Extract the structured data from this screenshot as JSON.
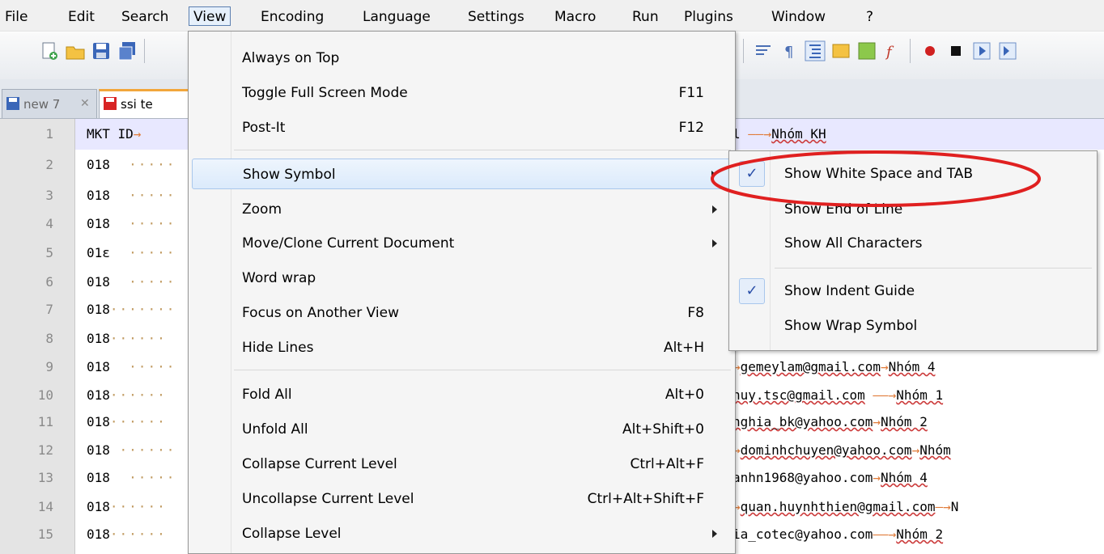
{
  "menubar": [
    {
      "label": "File",
      "open": false
    },
    {
      "label": "Edit",
      "open": false
    },
    {
      "label": "Search",
      "open": false
    },
    {
      "label": "View",
      "open": true
    },
    {
      "label": "Encoding",
      "open": false
    },
    {
      "label": "Language",
      "open": false
    },
    {
      "label": "Settings",
      "open": false
    },
    {
      "label": "Macro",
      "open": false
    },
    {
      "label": "Run",
      "open": false
    },
    {
      "label": "Plugins",
      "open": false
    },
    {
      "label": "Window",
      "open": false
    },
    {
      "label": "?",
      "open": false
    }
  ],
  "tabs": [
    {
      "label": "new  7",
      "active": false
    },
    {
      "label": "ssi te",
      "active": true
    }
  ],
  "editor": {
    "line_numbers": [
      "1",
      "2",
      "3",
      "4",
      "5",
      "6",
      "7",
      "8",
      "9",
      "10",
      "11",
      "12",
      "13",
      "14",
      "15"
    ],
    "header_text": "MKT ID",
    "left_codes": [
      "018",
      "018",
      "018",
      "01ε",
      "018",
      "018",
      "018",
      "018",
      "018",
      "018",
      "018",
      "018",
      "018",
      "018"
    ],
    "right_lines": [
      {
        "pre": "l ",
        "email": "Nhóm KH",
        "suffix": ""
      },
      {
        "pre": "",
        "email": "gemeylam@gmail.com",
        "suffix": "Nhóm 4"
      },
      {
        "pre": "",
        "email": "huy.tsc@gmail.com",
        "suffix": "Nhóm 1"
      },
      {
        "pre": "",
        "email": "nghia_bk@yahoo.com",
        "suffix": "Nhóm 2"
      },
      {
        "pre": "",
        "email": "dominhchuyen@yahoo.com",
        "suffix": "Nhóm"
      },
      {
        "pre": "",
        "email": "anhn1968@yahoo.com",
        "suffix": "Nhóm 4"
      },
      {
        "pre": "",
        "email": "quan.huynhthien@gmail.com",
        "suffix": "N"
      },
      {
        "pre": "",
        "email": "ia_cotec@yahoo.com",
        "suffix": "Nhóm 2"
      }
    ]
  },
  "view_menu": {
    "items": [
      {
        "label": "Always on Top",
        "shortcut": "",
        "submenu": false
      },
      {
        "label": "Toggle Full Screen Mode",
        "shortcut": "F11",
        "submenu": false
      },
      {
        "label": "Post-It",
        "shortcut": "F12",
        "submenu": false
      },
      {
        "label": "Show Symbol",
        "shortcut": "",
        "submenu": true,
        "highlighted": true
      },
      {
        "label": "Zoom",
        "shortcut": "",
        "submenu": true
      },
      {
        "label": "Move/Clone Current Document",
        "shortcut": "",
        "submenu": true
      },
      {
        "label": "Word wrap",
        "shortcut": "",
        "submenu": false
      },
      {
        "label": "Focus on Another View",
        "shortcut": "F8",
        "submenu": false
      },
      {
        "label": "Hide Lines",
        "shortcut": "Alt+H",
        "submenu": false
      },
      {
        "label": "Fold All",
        "shortcut": "Alt+0",
        "submenu": false
      },
      {
        "label": "Unfold All",
        "shortcut": "Alt+Shift+0",
        "submenu": false
      },
      {
        "label": "Collapse Current Level",
        "shortcut": "Ctrl+Alt+F",
        "submenu": false
      },
      {
        "label": "Uncollapse Current Level",
        "shortcut": "Ctrl+Alt+Shift+F",
        "submenu": false
      },
      {
        "label": "Collapse Level",
        "shortcut": "",
        "submenu": true
      }
    ]
  },
  "show_symbol_submenu": {
    "items": [
      {
        "label": "Show White Space and TAB",
        "checked": true
      },
      {
        "label": "Show End of Line",
        "checked": false
      },
      {
        "label": "Show All Characters",
        "checked": false
      },
      {
        "label": "Show Indent Guide",
        "checked": true
      },
      {
        "label": "Show Wrap Symbol",
        "checked": false
      }
    ],
    "check_glyph": "✓"
  },
  "annotation": {
    "color": "#e02020",
    "shape": "ellipse"
  }
}
